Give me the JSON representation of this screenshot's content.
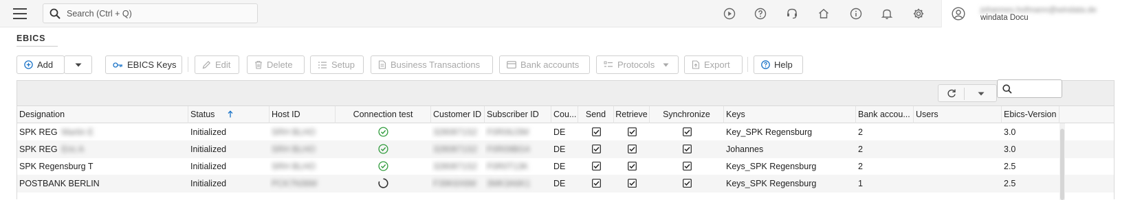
{
  "topbar": {
    "search_placeholder": "Search (Ctrl + Q)",
    "icons": [
      "play-icon",
      "help-circle-icon",
      "support-icon",
      "home-icon",
      "info-icon",
      "bell-icon",
      "gear-icon"
    ],
    "user": {
      "email": "johannes.hofmann@windata.de",
      "name": "windata Docu"
    }
  },
  "page": {
    "title": "EBICS"
  },
  "toolbar": {
    "add": "Add",
    "ebics_keys": "EBICS Keys",
    "edit": "Edit",
    "delete": "Delete",
    "setup": "Setup",
    "business_transactions": "Business Transactions",
    "bank_accounts": "Bank accounts",
    "protocols": "Protocols",
    "export": "Export",
    "help": "Help"
  },
  "grid": {
    "columns": {
      "designation": "Designation",
      "status": "Status",
      "host_id": "Host ID",
      "connection_test": "Connection test",
      "customer_id": "Customer ID",
      "subscriber_id": "Subscriber ID",
      "country": "Cou...",
      "send": "Send",
      "retrieve": "Retrieve",
      "synchronize": "Synchronize",
      "keys": "Keys",
      "bank_accounts": "Bank accou...",
      "users": "Users",
      "ebics_version": "Ebics-Version"
    },
    "sorted_column": "status",
    "rows": [
      {
        "designation": "SPK REG",
        "designation_blur": "Martin E",
        "status": "Initialized",
        "host_id": "SRH BLHO",
        "connection": "ok",
        "customer_id": "3280871S2",
        "subscriber_id": "F0R06J3M",
        "country": "DE",
        "send": true,
        "retrieve": true,
        "synchronize": true,
        "keys": "Key_SPK Regensburg",
        "bank_accounts": "2",
        "users": "",
        "ebics_version": "3.0"
      },
      {
        "designation": "SPK REG",
        "designation_blur": "Eric A",
        "status": "Initialized",
        "host_id": "SRH BLHO",
        "connection": "ok",
        "customer_id": "3280871S2",
        "subscriber_id": "F0R09BG4",
        "country": "DE",
        "send": true,
        "retrieve": true,
        "synchronize": true,
        "keys": "Johannes",
        "bank_accounts": "2",
        "users": "",
        "ebics_version": "3.0"
      },
      {
        "designation": "SPK Regensburg T",
        "designation_blur": "",
        "status": "Initialized",
        "host_id": "SRH BLHO",
        "connection": "ok",
        "customer_id": "3280871S2",
        "subscriber_id": "F0R0T13K",
        "country": "DE",
        "send": true,
        "retrieve": true,
        "synchronize": true,
        "keys": "Keys_SPK Regensburg",
        "bank_accounts": "2",
        "users": "",
        "ebics_version": "2.5"
      },
      {
        "designation": "POSTBANK BERLIN",
        "designation_blur": "",
        "status": "Initialized",
        "host_id": "PCK7N36M",
        "connection": "loading",
        "customer_id": "F39K6X6M",
        "subscriber_id": "3MK3A6K1",
        "country": "DE",
        "send": true,
        "retrieve": true,
        "synchronize": true,
        "keys": "Keys_SPK Regensburg",
        "bank_accounts": "1",
        "users": "",
        "ebics_version": "2.5"
      }
    ]
  },
  "colors": {
    "accent": "#1a73c8",
    "success": "#2e9b3a"
  }
}
